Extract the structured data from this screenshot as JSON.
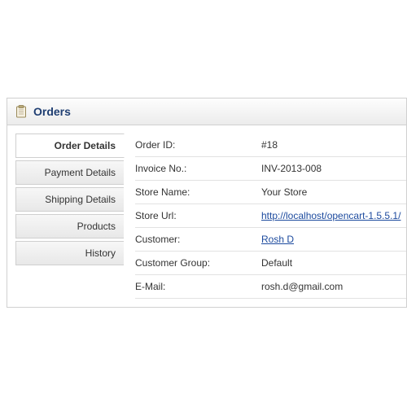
{
  "header": {
    "title": "Orders"
  },
  "tabs": {
    "order_details": "Order Details",
    "payment_details": "Payment Details",
    "shipping_details": "Shipping Details",
    "products": "Products",
    "history": "History"
  },
  "details": {
    "order_id": {
      "label": "Order ID:",
      "value": "#18"
    },
    "invoice_no": {
      "label": "Invoice No.:",
      "value": "INV-2013-008"
    },
    "store_name": {
      "label": "Store Name:",
      "value": "Your Store"
    },
    "store_url": {
      "label": "Store Url:",
      "value": "http://localhost/opencart-1.5.5.1/"
    },
    "customer": {
      "label": "Customer:",
      "value": "Rosh D"
    },
    "customer_group": {
      "label": "Customer Group:",
      "value": "Default"
    },
    "email": {
      "label": "E-Mail:",
      "value": "rosh.d@gmail.com"
    }
  }
}
